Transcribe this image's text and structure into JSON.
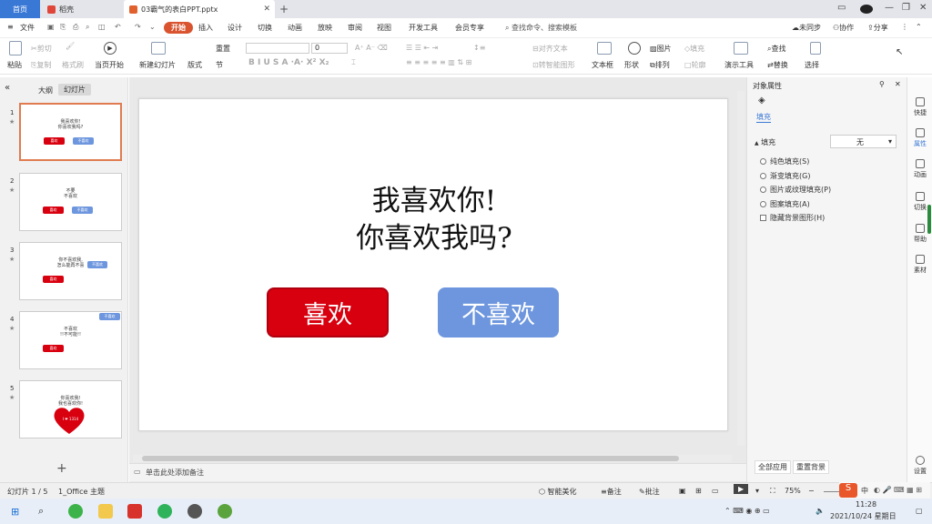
{
  "titlebar": {
    "tabs": [
      {
        "label": "首页"
      },
      {
        "label": "稻壳"
      },
      {
        "label": "03霸气的表白PPT.pptx"
      }
    ],
    "add_icon": "plus-icon"
  },
  "menubar": {
    "file": "文件",
    "items": [
      "开始",
      "插入",
      "设计",
      "切换",
      "动画",
      "放映",
      "审阅",
      "视图",
      "开发工具",
      "会员专享"
    ],
    "search": "查找命令、搜索模板",
    "sync": "未同步",
    "collab": "协作",
    "share": "分享"
  },
  "ribbon": {
    "paste": "粘贴",
    "cut": "剪切",
    "copy": "复制",
    "format_painter": "格式刷",
    "play_from_current": "当页开始",
    "new_slide": "新建幻灯片",
    "layout": "版式",
    "section": "节",
    "reset": "重置",
    "font_size": "0",
    "align_text": "对齐文本",
    "smart_shape": "转智能图形",
    "textbox": "文本框",
    "shape": "形状",
    "picture": "图片",
    "arrange": "排列",
    "fill": "填充",
    "outline": "轮廓",
    "presentation_tools": "演示工具",
    "find": "查找",
    "replace": "替换",
    "select": "选择"
  },
  "leftpanel": {
    "tab_outline": "大纲",
    "tab_slides": "幻灯片",
    "thumbs": [
      {
        "num": "1",
        "lines": [
          "我喜欢你!",
          "你喜欢我吗?"
        ],
        "red": "喜欢",
        "blue": "不喜欢"
      },
      {
        "num": "2",
        "lines": [
          "不要",
          "不喜欢"
        ],
        "red": "喜欢",
        "blue": "不喜欢"
      },
      {
        "num": "3",
        "lines": [
          "你不喜欢我,",
          "怎么能再不喜"
        ],
        "red": "喜欢",
        "blue": "不喜欢"
      },
      {
        "num": "4",
        "lines": [
          "不喜欢",
          "!!不可能!!"
        ],
        "red": "喜欢",
        "blue": "不喜欢"
      },
      {
        "num": "5",
        "lines": [
          "你喜欢我!",
          "我也喜欢你!"
        ],
        "heart": "I ❤ 1314"
      }
    ]
  },
  "slide": {
    "title_line1": "我喜欢你!",
    "title_line2": "你喜欢我吗?",
    "like": "喜欢",
    "dislike": "不喜欢",
    "like_color": "#d8000f",
    "dislike_color": "#6d96de"
  },
  "notes": {
    "placeholder": "单击此处添加备注"
  },
  "rightpane": {
    "title": "对象属性",
    "tab": "填充",
    "section": "填充",
    "fill_value": "无",
    "options": [
      "纯色填充(S)",
      "渐变填充(G)",
      "图片或纹理填充(P)",
      "图案填充(A)"
    ],
    "checkbox": "隐藏背景图形(H)",
    "apply_all": "全部应用",
    "reset_bg": "重置背景"
  },
  "siderail": [
    "快捷",
    "属性",
    "动画",
    "切换",
    "帮助",
    "素材",
    "设置"
  ],
  "statusbar": {
    "slide_info": "幻灯片 1 / 5",
    "theme": "1_Office 主题",
    "smart_beautify": "智能美化",
    "notes": "备注",
    "comments": "批注",
    "zoom": "75%"
  },
  "taskbar": {
    "time": "11:28",
    "date": "2021/10/24 星期日",
    "ime": "中"
  },
  "colors": {
    "accent": "#d9532e",
    "home_tab": "#3a78d6"
  }
}
